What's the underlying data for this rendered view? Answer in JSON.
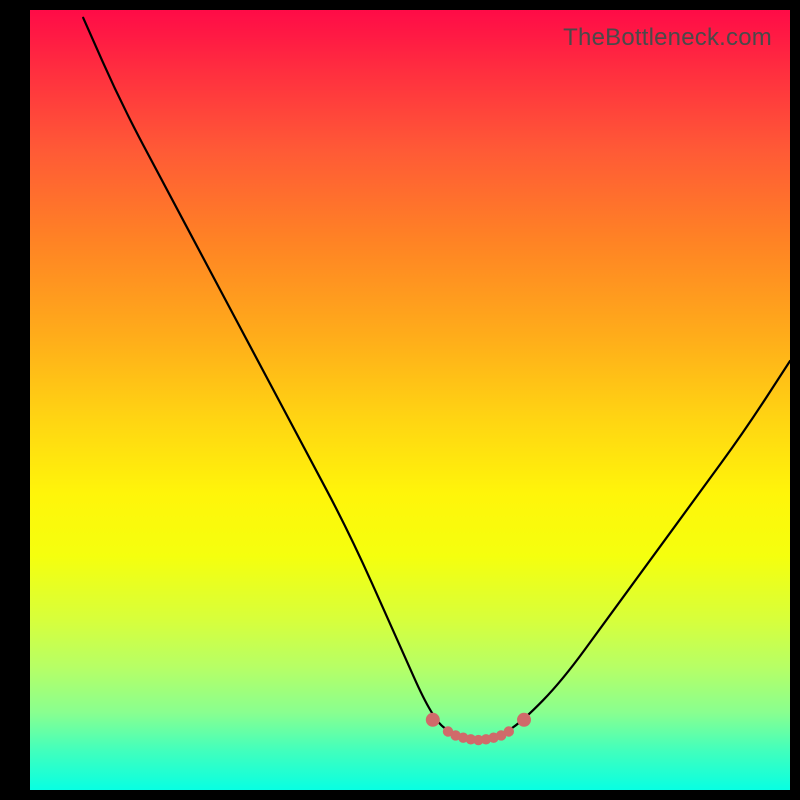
{
  "watermark": "TheBottleneck.com",
  "chart_data": {
    "type": "line",
    "title": "",
    "xlabel": "",
    "ylabel": "",
    "xlim": [
      0,
      100
    ],
    "ylim": [
      0,
      100
    ],
    "curve_note": "V-shaped bottleneck curve on a red→green vertical gradient; left branch starts near top-left and descends to a flat trough around x≈53–65 at y≈7, right branch rises to about y≈55 at x=100. Small pink markers along the trough.",
    "series": [
      {
        "name": "bottleneck-curve",
        "x": [
          7,
          12,
          18,
          24,
          30,
          36,
          42,
          48,
          53,
          56,
          59,
          62,
          65,
          70,
          76,
          82,
          88,
          94,
          100
        ],
        "y": [
          99,
          88,
          77,
          66,
          55,
          44,
          33,
          20,
          9,
          7,
          6,
          7,
          9,
          14,
          22,
          30,
          38,
          46,
          55
        ]
      }
    ],
    "markers": {
      "name": "trough-points",
      "color": "#d06a6a",
      "x": [
        53,
        55,
        56,
        57,
        58,
        59,
        60,
        61,
        62,
        63,
        65
      ],
      "y": [
        9,
        7.5,
        7,
        6.7,
        6.5,
        6.4,
        6.5,
        6.7,
        7,
        7.5,
        9
      ]
    }
  }
}
